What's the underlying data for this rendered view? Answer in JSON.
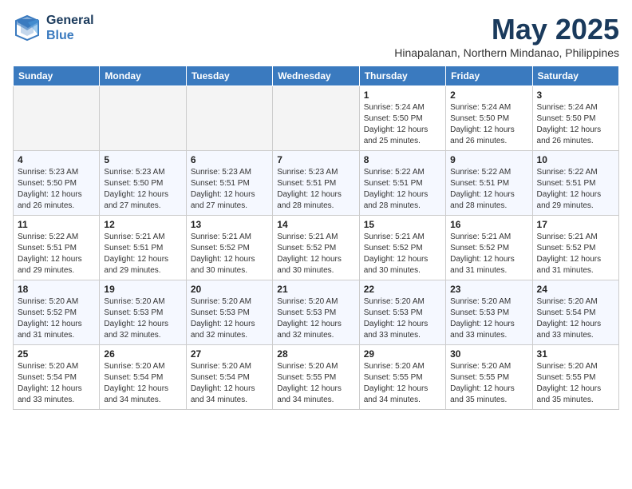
{
  "header": {
    "logo_line1": "General",
    "logo_line2": "Blue",
    "month_title": "May 2025",
    "subtitle": "Hinapalanan, Northern Mindanao, Philippines"
  },
  "days_of_week": [
    "Sunday",
    "Monday",
    "Tuesday",
    "Wednesday",
    "Thursday",
    "Friday",
    "Saturday"
  ],
  "weeks": [
    {
      "days": [
        {
          "num": "",
          "info": ""
        },
        {
          "num": "",
          "info": ""
        },
        {
          "num": "",
          "info": ""
        },
        {
          "num": "",
          "info": ""
        },
        {
          "num": "1",
          "info": "Sunrise: 5:24 AM\nSunset: 5:50 PM\nDaylight: 12 hours\nand 25 minutes."
        },
        {
          "num": "2",
          "info": "Sunrise: 5:24 AM\nSunset: 5:50 PM\nDaylight: 12 hours\nand 26 minutes."
        },
        {
          "num": "3",
          "info": "Sunrise: 5:24 AM\nSunset: 5:50 PM\nDaylight: 12 hours\nand 26 minutes."
        }
      ]
    },
    {
      "days": [
        {
          "num": "4",
          "info": "Sunrise: 5:23 AM\nSunset: 5:50 PM\nDaylight: 12 hours\nand 26 minutes."
        },
        {
          "num": "5",
          "info": "Sunrise: 5:23 AM\nSunset: 5:50 PM\nDaylight: 12 hours\nand 27 minutes."
        },
        {
          "num": "6",
          "info": "Sunrise: 5:23 AM\nSunset: 5:51 PM\nDaylight: 12 hours\nand 27 minutes."
        },
        {
          "num": "7",
          "info": "Sunrise: 5:23 AM\nSunset: 5:51 PM\nDaylight: 12 hours\nand 28 minutes."
        },
        {
          "num": "8",
          "info": "Sunrise: 5:22 AM\nSunset: 5:51 PM\nDaylight: 12 hours\nand 28 minutes."
        },
        {
          "num": "9",
          "info": "Sunrise: 5:22 AM\nSunset: 5:51 PM\nDaylight: 12 hours\nand 28 minutes."
        },
        {
          "num": "10",
          "info": "Sunrise: 5:22 AM\nSunset: 5:51 PM\nDaylight: 12 hours\nand 29 minutes."
        }
      ]
    },
    {
      "days": [
        {
          "num": "11",
          "info": "Sunrise: 5:22 AM\nSunset: 5:51 PM\nDaylight: 12 hours\nand 29 minutes."
        },
        {
          "num": "12",
          "info": "Sunrise: 5:21 AM\nSunset: 5:51 PM\nDaylight: 12 hours\nand 29 minutes."
        },
        {
          "num": "13",
          "info": "Sunrise: 5:21 AM\nSunset: 5:52 PM\nDaylight: 12 hours\nand 30 minutes."
        },
        {
          "num": "14",
          "info": "Sunrise: 5:21 AM\nSunset: 5:52 PM\nDaylight: 12 hours\nand 30 minutes."
        },
        {
          "num": "15",
          "info": "Sunrise: 5:21 AM\nSunset: 5:52 PM\nDaylight: 12 hours\nand 30 minutes."
        },
        {
          "num": "16",
          "info": "Sunrise: 5:21 AM\nSunset: 5:52 PM\nDaylight: 12 hours\nand 31 minutes."
        },
        {
          "num": "17",
          "info": "Sunrise: 5:21 AM\nSunset: 5:52 PM\nDaylight: 12 hours\nand 31 minutes."
        }
      ]
    },
    {
      "days": [
        {
          "num": "18",
          "info": "Sunrise: 5:20 AM\nSunset: 5:52 PM\nDaylight: 12 hours\nand 31 minutes."
        },
        {
          "num": "19",
          "info": "Sunrise: 5:20 AM\nSunset: 5:53 PM\nDaylight: 12 hours\nand 32 minutes."
        },
        {
          "num": "20",
          "info": "Sunrise: 5:20 AM\nSunset: 5:53 PM\nDaylight: 12 hours\nand 32 minutes."
        },
        {
          "num": "21",
          "info": "Sunrise: 5:20 AM\nSunset: 5:53 PM\nDaylight: 12 hours\nand 32 minutes."
        },
        {
          "num": "22",
          "info": "Sunrise: 5:20 AM\nSunset: 5:53 PM\nDaylight: 12 hours\nand 33 minutes."
        },
        {
          "num": "23",
          "info": "Sunrise: 5:20 AM\nSunset: 5:53 PM\nDaylight: 12 hours\nand 33 minutes."
        },
        {
          "num": "24",
          "info": "Sunrise: 5:20 AM\nSunset: 5:54 PM\nDaylight: 12 hours\nand 33 minutes."
        }
      ]
    },
    {
      "days": [
        {
          "num": "25",
          "info": "Sunrise: 5:20 AM\nSunset: 5:54 PM\nDaylight: 12 hours\nand 33 minutes."
        },
        {
          "num": "26",
          "info": "Sunrise: 5:20 AM\nSunset: 5:54 PM\nDaylight: 12 hours\nand 34 minutes."
        },
        {
          "num": "27",
          "info": "Sunrise: 5:20 AM\nSunset: 5:54 PM\nDaylight: 12 hours\nand 34 minutes."
        },
        {
          "num": "28",
          "info": "Sunrise: 5:20 AM\nSunset: 5:55 PM\nDaylight: 12 hours\nand 34 minutes."
        },
        {
          "num": "29",
          "info": "Sunrise: 5:20 AM\nSunset: 5:55 PM\nDaylight: 12 hours\nand 34 minutes."
        },
        {
          "num": "30",
          "info": "Sunrise: 5:20 AM\nSunset: 5:55 PM\nDaylight: 12 hours\nand 35 minutes."
        },
        {
          "num": "31",
          "info": "Sunrise: 5:20 AM\nSunset: 5:55 PM\nDaylight: 12 hours\nand 35 minutes."
        }
      ]
    }
  ]
}
